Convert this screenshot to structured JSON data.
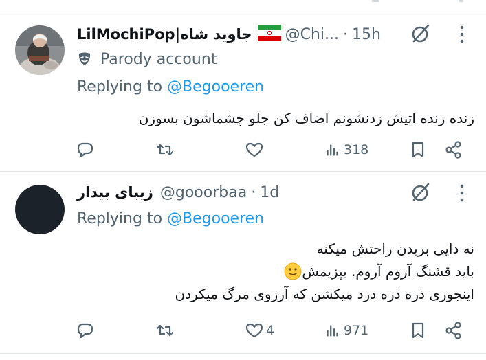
{
  "tweets": [
    {
      "display_name": "LilMochiPop|جاوید شاه",
      "handle": "@Chi...",
      "separator": "·",
      "time": "15h",
      "parody_label": "Parody account",
      "replying_prefix": "Replying to",
      "replying_to": "@Begooeren",
      "text_lines": [
        "زنده زنده اتیش زدنشونم اضاف کن جلو چشماشون بسوزن"
      ],
      "views": "318",
      "likes": "",
      "colors": {
        "flag_green": "#239f40",
        "flag_red": "#da0000"
      }
    },
    {
      "display_name": "زیبای بیدار",
      "handle": "@gooorbaa",
      "separator": "·",
      "time": "1d",
      "replying_prefix": "Replying to",
      "replying_to": "@Begooeren",
      "text_lines": [
        "نه دایی بریدن راحتش میکنه",
        "باید قشنگ آروم آروم. بپزیمش",
        "اینجوری ذره ذره درد میکشن که آرزوی مرگ میکردن"
      ],
      "emoji": "slightly-smiling-face",
      "views": "971",
      "likes": "4"
    }
  ],
  "colors": {
    "text": "#0f1419",
    "secondary": "#536471",
    "accent": "#1d9bf0",
    "divider": "#e1e6ea"
  }
}
